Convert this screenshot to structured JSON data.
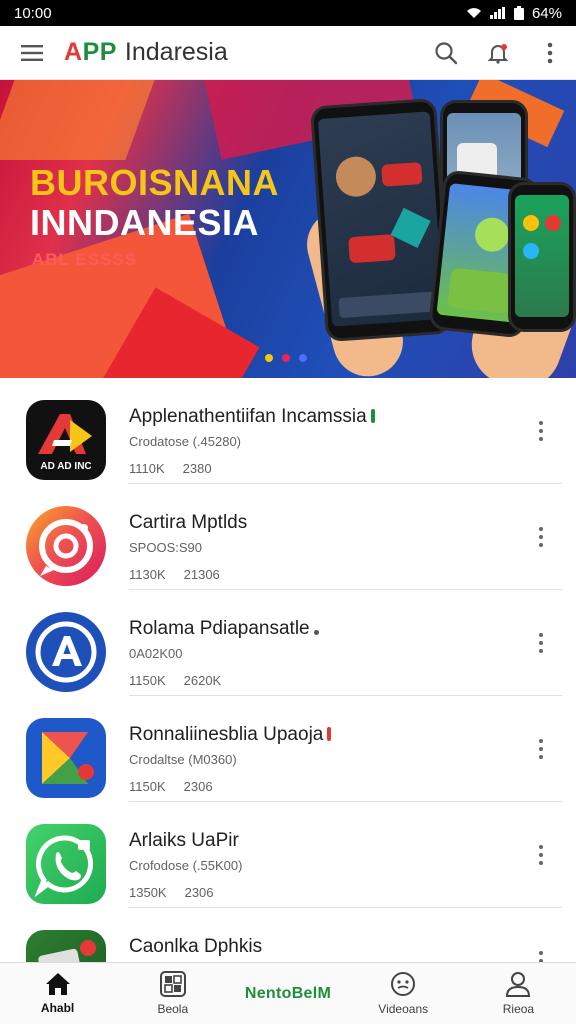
{
  "status_bar": {
    "time": "10:00",
    "battery_text": "64%",
    "icons": [
      "wifi-icon",
      "signal-icon",
      "battery-icon"
    ]
  },
  "app_bar": {
    "brand_accent_a": "A",
    "brand_accent_rest": "PP",
    "brand_rest": "Indaresia",
    "icons": [
      "menu-icon",
      "search-icon",
      "notification-icon",
      "more-vert-icon"
    ]
  },
  "banner": {
    "title_line1": "BUROISNANA",
    "title_line2": "INNDANESIA",
    "subtitle": "ABL ESSSS",
    "carousel_dot_colors": [
      "#f5c518",
      "#e8265a",
      "#4f6df5"
    ]
  },
  "apps": [
    {
      "name": "Applenathentiifan Incamssia",
      "developer": "Crodatose (.45280)",
      "stat1": "1110K",
      "stat2": "2380",
      "icon": "ad-app-icon",
      "icon_caption": "AD AD INC",
      "mark_color": "#1e8e3e"
    },
    {
      "name": "Cartira Mptlds",
      "developer": "SPOOS:S90",
      "stat1": "1130K",
      "stat2": "21306",
      "icon": "camera-chat-icon",
      "mark_color": ""
    },
    {
      "name": "Rolama Pdiapansatle",
      "developer": "0A02K00",
      "stat1": "1150K",
      "stat2": "2620K",
      "icon": "letter-a-icon",
      "mark_color": "#555555"
    },
    {
      "name": "Ronnaliinesblia Upaoja",
      "developer": "Crodaltse (M0360)",
      "stat1": "1150K",
      "stat2": "2306",
      "icon": "play-store-icon",
      "mark_color": "#e53935"
    },
    {
      "name": "Arlaiks UaPir",
      "developer": "Crofodose (.55K00)",
      "stat1": "1350K",
      "stat2": "2306",
      "icon": "phone-chat-icon",
      "mark_color": ""
    },
    {
      "name": "Caonlka Dphkis",
      "developer": "",
      "stat1": "",
      "stat2": "",
      "icon": "card-app-icon",
      "mark_color": ""
    }
  ],
  "bottom_nav": [
    {
      "label": "Ahabl",
      "icon": "home-icon",
      "active": true
    },
    {
      "label": "Beola",
      "icon": "apps-icon",
      "active": false
    },
    {
      "label": "NentoBelM",
      "icon": "",
      "active": false
    },
    {
      "label": "Videoans",
      "icon": "face-icon",
      "active": false
    },
    {
      "label": "Rieoa",
      "icon": "profile-icon",
      "active": false
    }
  ]
}
